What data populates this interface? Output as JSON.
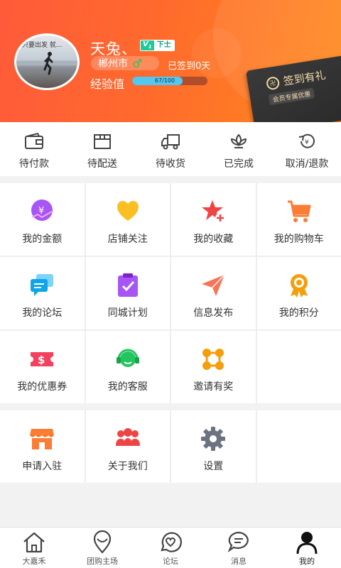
{
  "profile": {
    "username": "天兔、",
    "vip_mark": "V",
    "vip_level_mark": "1",
    "level": "下士",
    "city": "郴州市",
    "gender_symbol": "♂",
    "checkin_status": "已签到0天",
    "exp_label": "经验值",
    "exp_text": "67/100",
    "exp_fraction": 0.67,
    "avatar_caption": "只要出发 就..."
  },
  "vip_card": {
    "title": "签到有礼",
    "subtitle": "会员专属优惠"
  },
  "orders": [
    {
      "label": "待付款",
      "icon": "wallet-icon"
    },
    {
      "label": "待配送",
      "icon": "package-icon"
    },
    {
      "label": "待收货",
      "icon": "truck-icon"
    },
    {
      "label": "已完成",
      "icon": "lotus-icon"
    },
    {
      "label": "取消/退款",
      "icon": "refund-icon"
    }
  ],
  "menu": [
    {
      "label": "我的金额",
      "icon": "wallet-yen-icon",
      "color": "#a855f7"
    },
    {
      "label": "店铺关注",
      "icon": "heart-icon",
      "color": "#fbbf24"
    },
    {
      "label": "我的收藏",
      "icon": "star-plus-icon",
      "color": "#ef4444"
    },
    {
      "label": "我的购物车",
      "icon": "cart-icon",
      "color": "#fb7c35"
    },
    {
      "label": "我的论坛",
      "icon": "chat-bubbles-icon",
      "color": "#38bdf8"
    },
    {
      "label": "同城计划",
      "icon": "clipboard-check-icon",
      "color": "#a855f7"
    },
    {
      "label": "信息发布",
      "icon": "paper-plane-icon",
      "color": "#f97356"
    },
    {
      "label": "我的积分",
      "icon": "medal-icon",
      "color": "#f59e0b"
    },
    {
      "label": "我的优惠券",
      "icon": "coupon-icon",
      "color": "#f43f5e"
    },
    {
      "label": "我的客服",
      "icon": "headset-icon",
      "color": "#22c55e"
    },
    {
      "label": "邀请有奖",
      "icon": "share-nodes-icon",
      "color": "#f59e0b"
    }
  ],
  "menu2": [
    {
      "label": "申请入驻",
      "icon": "store-icon",
      "color": "#fb7c35"
    },
    {
      "label": "关于我们",
      "icon": "group-icon",
      "color": "#ef4444"
    },
    {
      "label": "设置",
      "icon": "gear-icon",
      "color": "#6b7280"
    }
  ],
  "tabs": [
    {
      "label": "大嘉禾",
      "icon": "home-icon"
    },
    {
      "label": "团购主场",
      "icon": "map-pin-icon"
    },
    {
      "label": "论坛",
      "icon": "heart-bubble-icon"
    },
    {
      "label": "消息",
      "icon": "message-icon"
    },
    {
      "label": "我的",
      "icon": "person-icon",
      "active": true
    }
  ]
}
